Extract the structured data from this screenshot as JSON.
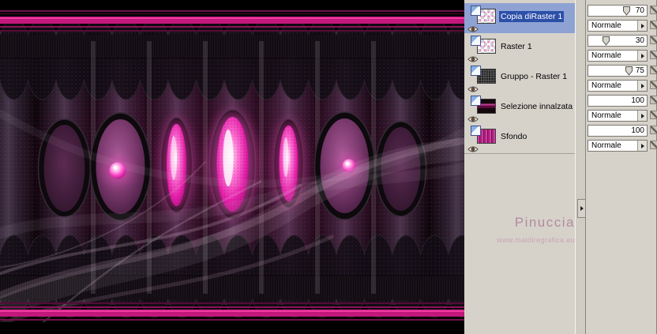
{
  "canvas": {
    "watermark_title": "Pinuccia",
    "watermark_url": "www.maidiregrafica.eu"
  },
  "layers_panel": {
    "layers": [
      {
        "name": "Copia diRaster 1",
        "opacity": "70",
        "blend_mode": "Normale",
        "selected": true
      },
      {
        "name": "Raster 1",
        "opacity": "30",
        "blend_mode": "Normale",
        "selected": false
      },
      {
        "name": "Gruppo - Raster 1",
        "opacity": "75",
        "blend_mode": "Normale",
        "selected": false
      },
      {
        "name": "Selezione innalzata",
        "opacity": "100",
        "blend_mode": "Normale",
        "selected": false
      },
      {
        "name": "Sfondo",
        "opacity": "100",
        "blend_mode": "Normale",
        "selected": false
      }
    ],
    "colors": {
      "selection_blue": "#2c4fa8",
      "panel_gray": "#d6d2ca",
      "accent_magenta": "#c2187c"
    },
    "icons": {
      "visibility": "eye-icon",
      "layer_type": "raster-layer-icon",
      "dropdown_arrow": "right-triangle",
      "splitter_arrow": "right-triangle",
      "slider_thumb": "pentagon-down",
      "side_tools": "edit-pencil-icon / link-layer-icon"
    }
  }
}
